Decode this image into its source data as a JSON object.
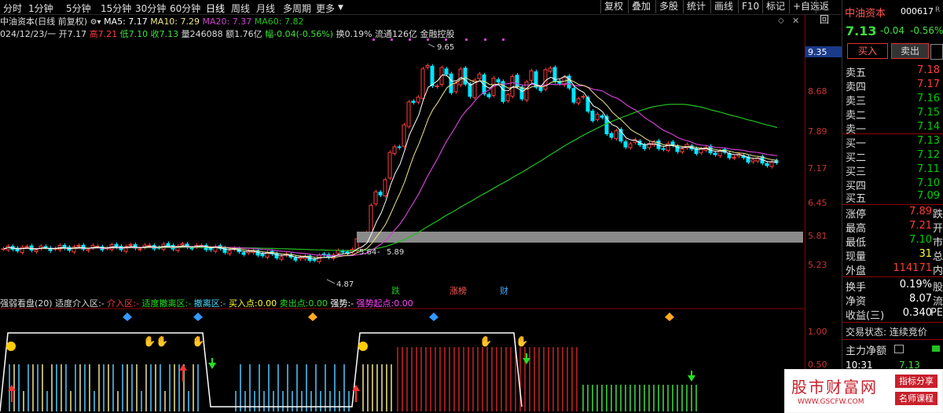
{
  "toolbar": {
    "periods": [
      "分时",
      "1分钟",
      "5分钟",
      "15分钟",
      "30分钟",
      "60分钟",
      "日线",
      "周线",
      "月线",
      "多周期",
      "更多"
    ],
    "active_period": "日线",
    "right_buttons": [
      "复权",
      "叠加",
      "多股",
      "统计",
      "画线",
      "F10",
      "标记",
      "+自选",
      "返回"
    ]
  },
  "info": {
    "stock_title": "中油资本(日线 前复权)",
    "ma5": "MA5: 7.17",
    "ma10": "MA10: 7.29",
    "ma20": "MA20: 7.37",
    "ma60": "MA60: 7.82",
    "line2_date": "024/12/23/一",
    "open": "开7.17",
    "high": "高7.21",
    "low": "低7.10",
    "close": "收7.13",
    "volume": "量246088",
    "amount": "额1.76亿",
    "change": "幅-0.04(-0.56%)",
    "turnover": "换0.19%",
    "float": "流通126亿",
    "concept": "金融控股"
  },
  "main_chart": {
    "marks": {
      "high": "9.65",
      "range_low": "5.64",
      "range_high": "5.89",
      "low": "4.87"
    },
    "tags": [
      "跌",
      "涨榜",
      "财"
    ],
    "colors": {
      "up": "#ff3b3b",
      "down": "#00e5ff",
      "ma5": "#ffffff",
      "ma10": "#f0e68c",
      "ma20": "#d040d0",
      "ma60": "#22c022",
      "axis": "#cc2222"
    }
  },
  "axis": {
    "price_labels": [
      "9.35",
      "8.68",
      "7.89",
      "7.17",
      "6.45",
      "5.81",
      "5.23"
    ],
    "sub_labels": [
      "1.00",
      "0.50"
    ]
  },
  "sub_chart": {
    "title": "强弱看盘(20)",
    "items": [
      {
        "label": "适度介入区:",
        "value": "-"
      },
      {
        "label": "介入区:",
        "value": "-"
      },
      {
        "label": "适度撤离区:",
        "value": "-"
      },
      {
        "label": "撤离区:",
        "value": "-"
      },
      {
        "label": "买入点:",
        "value": "0.00"
      },
      {
        "label": "卖出点:",
        "value": "0.00"
      },
      {
        "label": "强势:",
        "value": "-"
      },
      {
        "label": "强势起点:",
        "value": "0.00"
      }
    ]
  },
  "panel": {
    "name": "中油资本",
    "code": "000617",
    "code_suffix": "R",
    "price": "7.13",
    "change": "-0.04",
    "change_pct": "-0.56%",
    "buy_btn": "买入",
    "sell_btn": "卖出",
    "asks": [
      {
        "label": "卖五",
        "price": "7.18"
      },
      {
        "label": "卖四",
        "price": "7.17"
      },
      {
        "label": "卖三",
        "price": "7.16"
      },
      {
        "label": "卖二",
        "price": "7.15"
      },
      {
        "label": "卖一",
        "price": "7.14"
      }
    ],
    "bids": [
      {
        "label": "买一",
        "price": "7.13"
      },
      {
        "label": "买二",
        "price": "7.12"
      },
      {
        "label": "买三",
        "price": "7.11"
      },
      {
        "label": "买四",
        "price": "7.10"
      },
      {
        "label": "买五",
        "price": "7.09"
      }
    ],
    "stats": [
      {
        "label": "涨停",
        "value": "7.89",
        "extra": "跌"
      },
      {
        "label": "最高",
        "value": "7.21",
        "extra": "开"
      },
      {
        "label": "最低",
        "value": "7.10",
        "extra": "市"
      },
      {
        "label": "现量",
        "value": "31",
        "extra": "总"
      },
      {
        "label": "外盘",
        "value": "114171",
        "extra": "内"
      }
    ],
    "stats2": [
      {
        "label": "换手",
        "value": "0.19%",
        "extra": "股"
      },
      {
        "label": "净资",
        "value": "8.07",
        "extra": "流"
      },
      {
        "label": "收益(三)",
        "value": "0.340",
        "extra": "PE"
      }
    ],
    "trade_status": "交易状态: 连续竞价",
    "net_flow": "主力净额",
    "time": "10:31",
    "time_price": "7.13"
  },
  "watermark": {
    "title": "股市财富网",
    "site": "WWW.GSCFW.COM",
    "tag1": "指标分享",
    "tag2": "名师课程"
  }
}
